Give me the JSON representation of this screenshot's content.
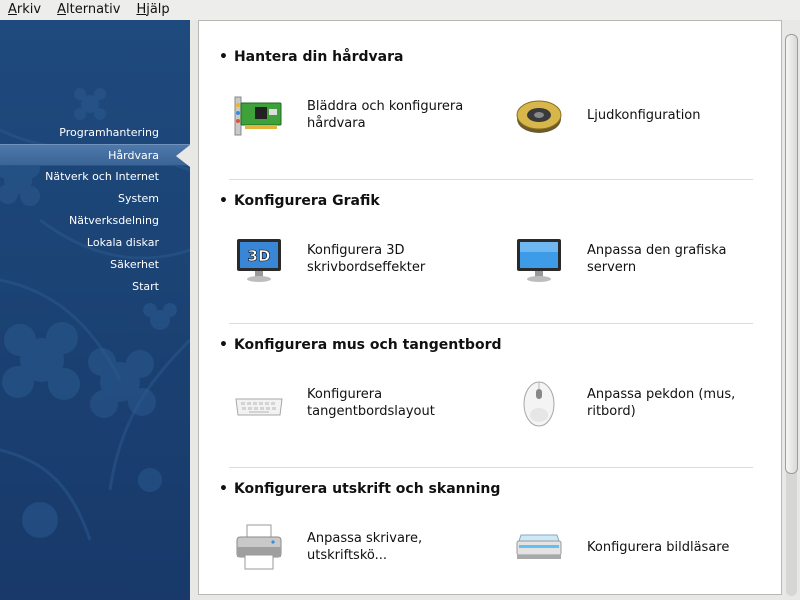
{
  "menubar": {
    "items": [
      {
        "label": "Arkiv"
      },
      {
        "label": "Alternativ"
      },
      {
        "label": "Hjälp"
      }
    ]
  },
  "sidebar": {
    "items": [
      {
        "label": "Programhantering"
      },
      {
        "label": "Hårdvara",
        "active": true
      },
      {
        "label": "Nätverk och Internet"
      },
      {
        "label": "System"
      },
      {
        "label": "Nätverksdelning"
      },
      {
        "label": "Lokala diskar"
      },
      {
        "label": "Säkerhet"
      },
      {
        "label": "Start"
      }
    ]
  },
  "sections": [
    {
      "title": "Hantera din hårdvara",
      "entries": [
        {
          "label": "Bläddra och konfigurera\nhårdvara",
          "icon": "pci-card-icon"
        },
        {
          "label": "Ljudkonfiguration",
          "icon": "speaker-icon"
        }
      ]
    },
    {
      "title": "Konfigurera Grafik",
      "entries": [
        {
          "label": "Konfigurera 3D\nskrivbordseffekter",
          "icon": "3d-monitor-icon",
          "icon_text": "3D"
        },
        {
          "label": "Anpassa den grafiska\nservern",
          "icon": "monitor-icon"
        }
      ]
    },
    {
      "title": "Konfigurera mus och tangentbord",
      "entries": [
        {
          "label": "Konfigurera\ntangentbordslayout",
          "icon": "keyboard-icon"
        },
        {
          "label": "Anpassa pekdon (mus,\nritbord)",
          "icon": "mouse-icon"
        }
      ]
    },
    {
      "title": "Konfigurera utskrift och skanning",
      "entries": [
        {
          "label": "Anpassa skrivare,\nutskriftskö...",
          "icon": "printer-icon"
        },
        {
          "label": "Konfigurera bildläsare",
          "icon": "scanner-icon"
        }
      ]
    }
  ],
  "colors": {
    "sidebar_bg": "#1b4374",
    "sidebar_active": "#4f79aa",
    "content_bg": "#ffffff",
    "window_bg": "#e8e8e7"
  }
}
